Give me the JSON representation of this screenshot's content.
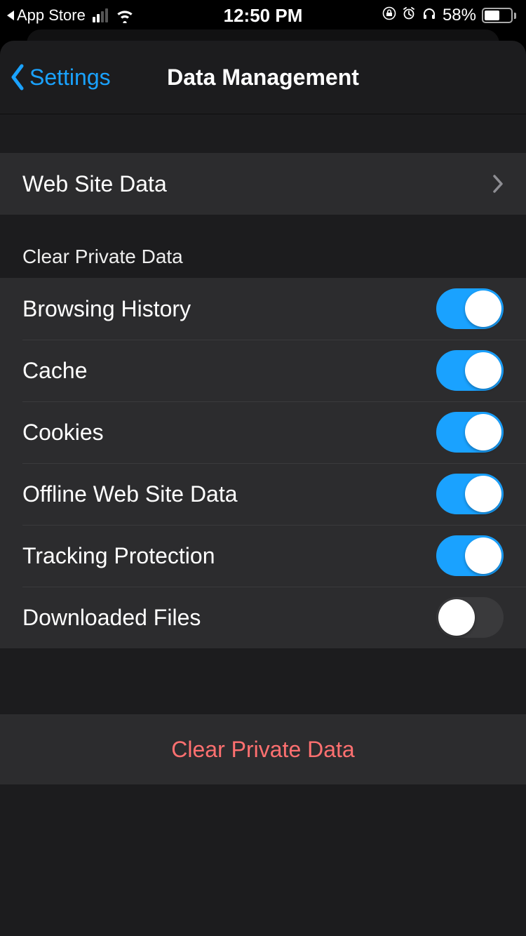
{
  "status": {
    "back_app": "App Store",
    "time": "12:50 PM",
    "battery_pct": "58%",
    "battery_fill_pct": 58
  },
  "nav": {
    "back_label": "Settings",
    "title": "Data Management"
  },
  "rows": {
    "web_site_data": "Web Site Data"
  },
  "section": {
    "header": "Clear Private Data",
    "items": [
      {
        "label": "Browsing History",
        "on": true
      },
      {
        "label": "Cache",
        "on": true
      },
      {
        "label": "Cookies",
        "on": true
      },
      {
        "label": "Offline Web Site Data",
        "on": true
      },
      {
        "label": "Tracking Protection",
        "on": true
      },
      {
        "label": "Downloaded Files",
        "on": false
      }
    ]
  },
  "action": {
    "clear_label": "Clear Private Data"
  },
  "colors": {
    "accent": "#1aa2ff",
    "danger": "#ff7070",
    "cell_bg": "#2c2c2e",
    "sheet_bg": "#1c1c1e"
  }
}
